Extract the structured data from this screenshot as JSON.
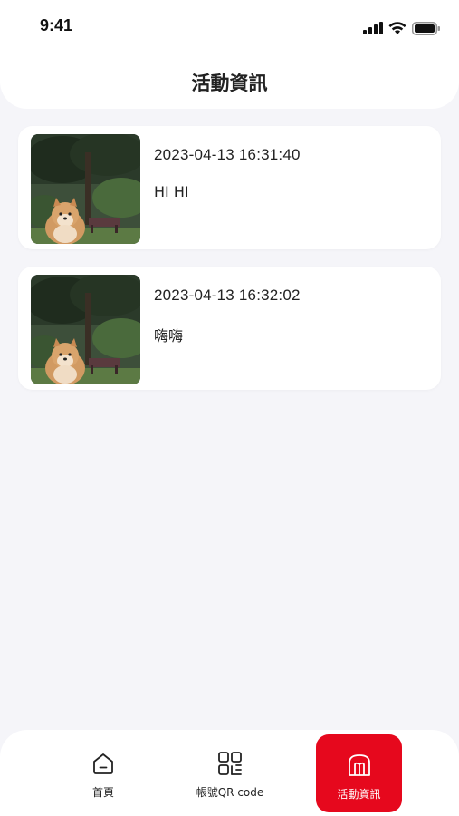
{
  "status_bar": {
    "time": "9:41"
  },
  "header": {
    "title": "活動資訊"
  },
  "activities": [
    {
      "datetime": "2023-04-13 16:31:40",
      "message": "HI HI",
      "image": "shiba-dog-photo"
    },
    {
      "datetime": "2023-04-13 16:32:02",
      "message": "嗨嗨",
      "image": "shiba-dog-photo"
    }
  ],
  "tabbar": {
    "items": [
      {
        "label": "首頁",
        "icon": "home-icon",
        "active": false
      },
      {
        "label": "帳號QR code",
        "icon": "qr-code-icon",
        "active": false
      },
      {
        "label": "活動資訊",
        "icon": "activity-info-icon",
        "active": true
      }
    ]
  },
  "colors": {
    "accent": "#e6081d",
    "background": "#f5f5f9",
    "card": "#ffffff"
  }
}
